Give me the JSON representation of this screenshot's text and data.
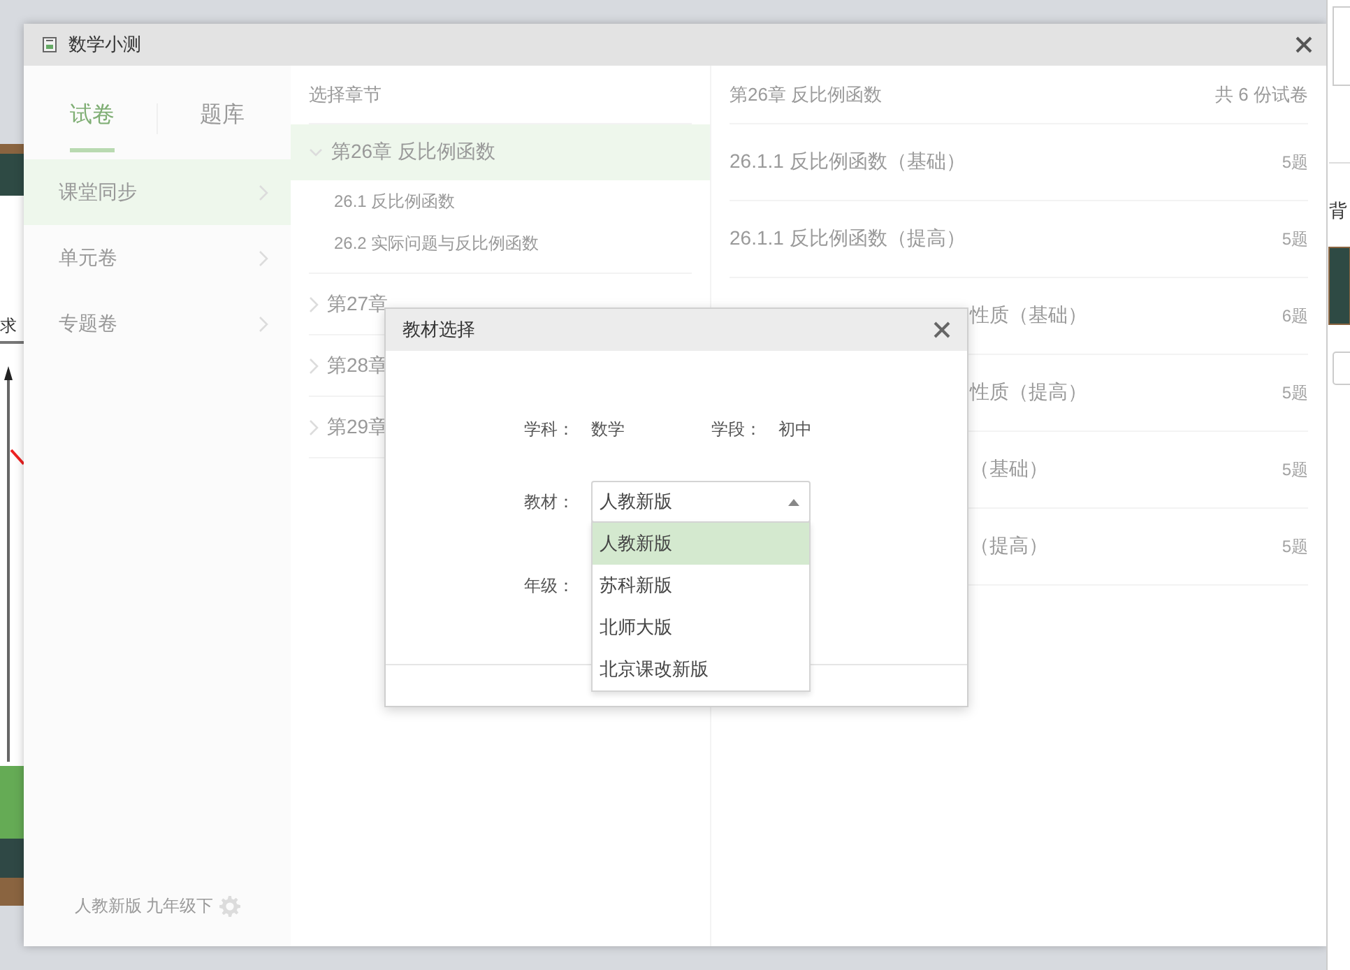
{
  "left_app": {
    "text": "求"
  },
  "right_app": {
    "text": "背"
  },
  "window": {
    "title": "数学小测"
  },
  "tabs": [
    {
      "label": "试卷",
      "selected": true
    },
    {
      "label": "题库",
      "selected": false
    }
  ],
  "menu": [
    {
      "label": "课堂同步",
      "selected": true
    },
    {
      "label": "单元卷",
      "selected": false
    },
    {
      "label": "专题卷",
      "selected": false
    }
  ],
  "footer": {
    "text": "人教新版 九年级下"
  },
  "chapters": {
    "header": "选择章节",
    "items": [
      {
        "label": "第26章 反比例函数",
        "selected": true,
        "expanded": true,
        "children": [
          {
            "label": "26.1 反比例函数"
          },
          {
            "label": "26.2 实际问题与反比例函数"
          }
        ]
      },
      {
        "label": "第27章",
        "selected": false,
        "expanded": false
      },
      {
        "label": "第28章",
        "selected": false,
        "expanded": false
      },
      {
        "label": "第29章",
        "selected": false,
        "expanded": false
      }
    ]
  },
  "papers": {
    "title": "第26章 反比例函数",
    "count": "共 6 份试卷",
    "rows": [
      {
        "kind": "full",
        "title": "26.1.1 反比例函数（基础）",
        "count": "5题"
      },
      {
        "kind": "full",
        "title": "26.1.1 反比例函数（提高）",
        "count": "5题"
      },
      {
        "kind": "covered",
        "title": "性质（基础）",
        "count": "6题"
      },
      {
        "kind": "covered",
        "title": "性质（提高）",
        "count": "5题"
      },
      {
        "kind": "covered",
        "title": "（基础）",
        "count": "5题"
      },
      {
        "kind": "covered",
        "title": "（提高）",
        "count": "5题"
      }
    ]
  },
  "dialog": {
    "title": "教材选择",
    "subject_label": "学科：",
    "subject": "数学",
    "stage_label": "学段：",
    "stage": "初中",
    "textbook_label": "教材：",
    "textbook": {
      "value": "人教新版",
      "expanded": true,
      "options": [
        {
          "label": "人教新版",
          "selected": true
        },
        {
          "label": "苏科新版",
          "selected": false
        },
        {
          "label": "北师大版",
          "selected": false
        },
        {
          "label": "北京课改新版",
          "selected": false
        }
      ]
    },
    "grade_label": "年级："
  }
}
